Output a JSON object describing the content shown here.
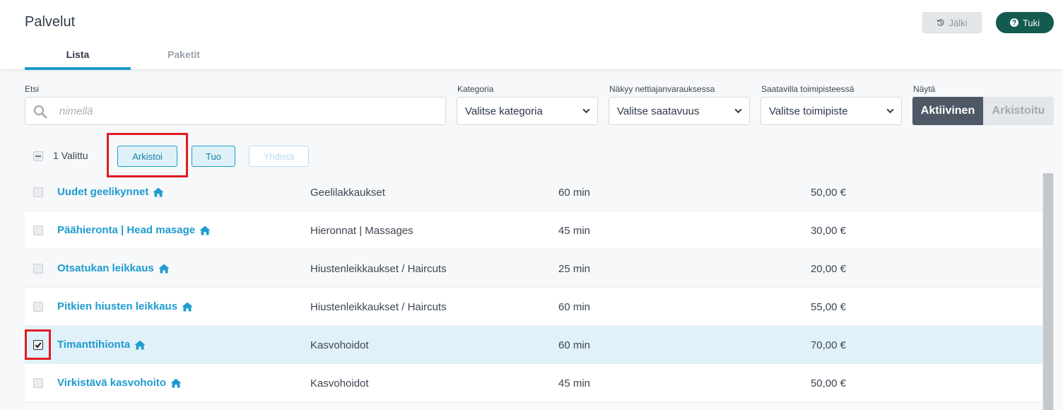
{
  "header": {
    "title": "Palvelut",
    "history_label": "Jälki",
    "help_label": "Tuki"
  },
  "tabs": [
    {
      "label": "Lista",
      "active": true
    },
    {
      "label": "Paketit",
      "active": false
    }
  ],
  "filters": {
    "search": {
      "label": "Etsi",
      "placeholder": "nimellä",
      "value": ""
    },
    "category": {
      "label": "Kategoria",
      "value": "Valitse kategoria"
    },
    "availability": {
      "label": "Näkyy nettiajanvarauksessa",
      "value": "Valitse saatavuus"
    },
    "location": {
      "label": "Saatavilla toimipisteessä",
      "value": "Valitse toimipiste"
    },
    "show": {
      "label": "Näytä",
      "options": [
        "Aktiivinen",
        "Arkistoitu"
      ],
      "selected": "Aktiivinen"
    }
  },
  "bulk": {
    "selected_label": "1 Valittu",
    "archive_label": "Arkistoi",
    "import_label": "Tuo",
    "merge_label": "Yhdistä"
  },
  "services": [
    {
      "name": "Uudet geelikynnet",
      "category": "Geelilakkaukset",
      "duration": "60 min",
      "price": "50,00 €",
      "checked": false
    },
    {
      "name": "Päähieronta | Head masage",
      "category": "Hieronnat | Massages",
      "duration": "45 min",
      "price": "30,00 €",
      "checked": false
    },
    {
      "name": "Otsatukan leikkaus",
      "category": "Hiustenleikkaukset / Haircuts",
      "duration": "25 min",
      "price": "20,00 €",
      "checked": false
    },
    {
      "name": "Pitkien hiusten leikkaus",
      "category": "Hiustenleikkaukset / Haircuts",
      "duration": "60 min",
      "price": "55,00 €",
      "checked": false
    },
    {
      "name": "Timanttihionta",
      "category": "Kasvohoidot",
      "duration": "60 min",
      "price": "70,00 €",
      "checked": true
    },
    {
      "name": "Virkistävä kasvohoito",
      "category": "Kasvohoidot",
      "duration": "45 min",
      "price": "50,00 €",
      "checked": false
    }
  ],
  "colors": {
    "accent": "#1e9ccf",
    "help_button": "#135a4f",
    "segment_active": "#4e5866",
    "highlight": "#e21b23"
  }
}
